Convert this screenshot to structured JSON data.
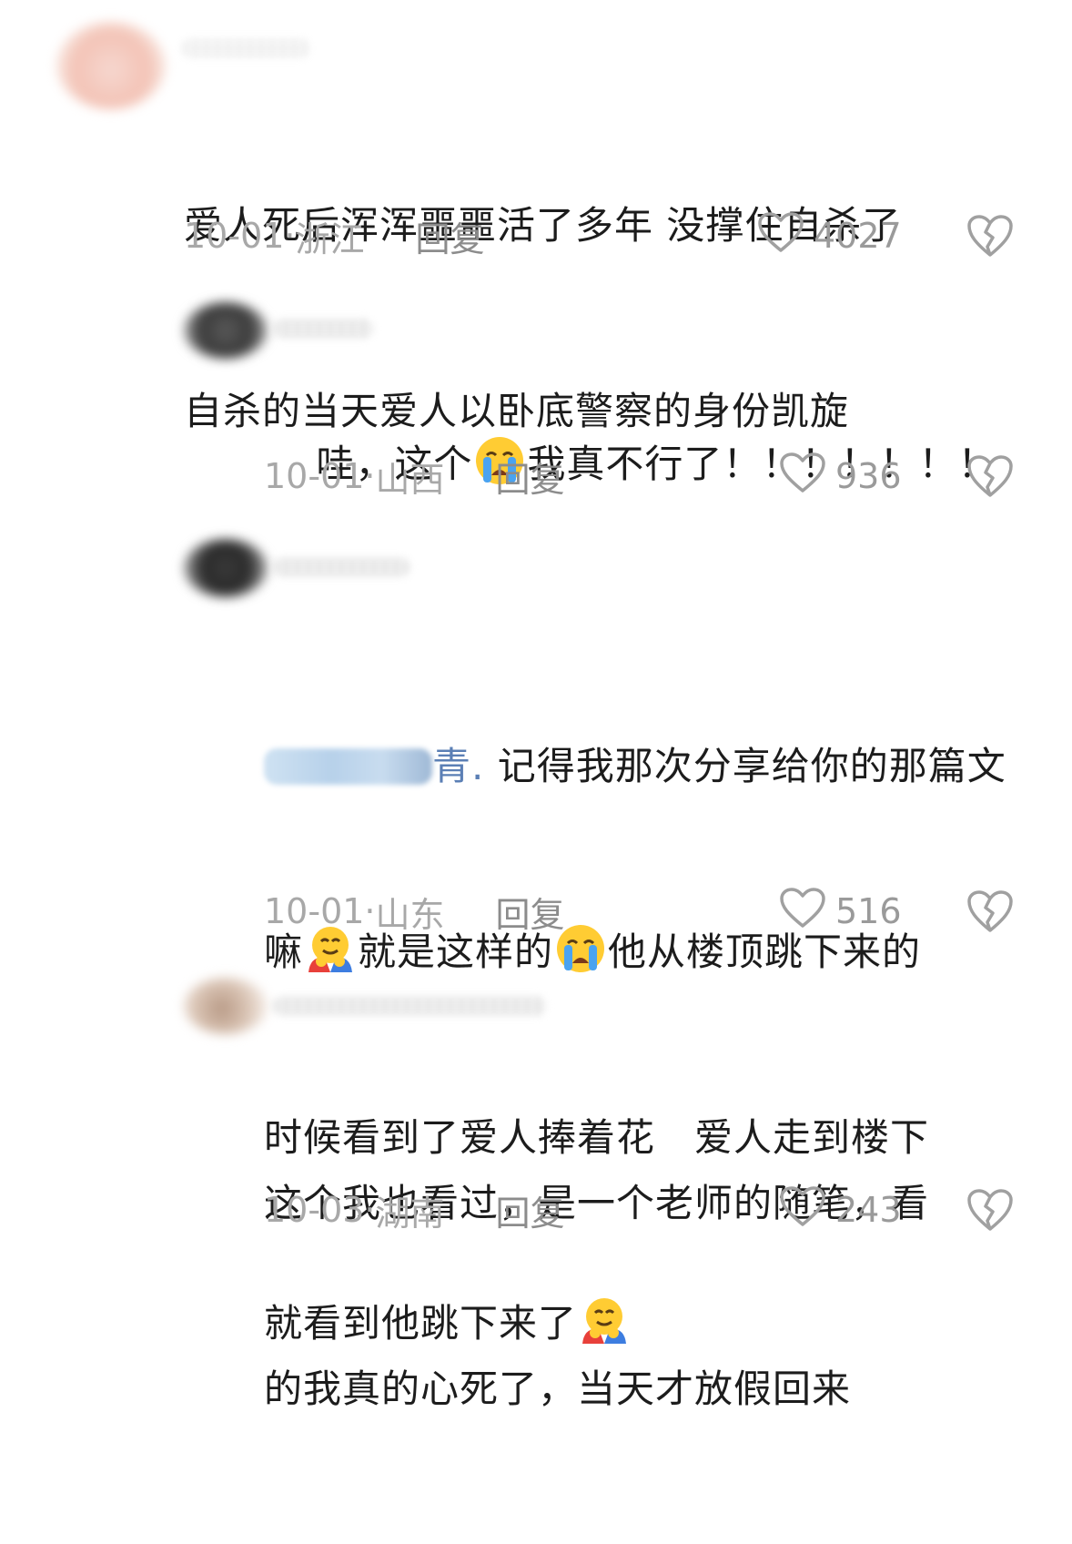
{
  "comments": [
    {
      "lines": [
        "爱人死后浑浑噩噩活了多年 没撑住自杀了",
        "自杀的当天爱人以卧底警察的身份凯旋"
      ],
      "date": "10-01",
      "region": "浙江",
      "reply_label": "回复",
      "likes": "4027"
    },
    {
      "text_a": "哇，这个",
      "text_b": "我真不行了！！！！！！！",
      "emoji": "loudly-crying-face",
      "date": "10-01",
      "region": "山西",
      "reply_label": "回复",
      "likes": "936"
    },
    {
      "mention_suffix": "青.",
      "line1": " 记得我那次分享给你的那篇文",
      "line2a": "嘛",
      "line2b": "就是这样的",
      "line2c": "他从楼顶跳下来的",
      "line3": "时候看到了爱人捧着花　爱人走到楼下",
      "line4": "就看到他跳下来了",
      "emojis": [
        "hugging-face",
        "loudly-crying-face",
        "hugging-face"
      ],
      "date": "10-01",
      "region": "山东",
      "reply_label": "回复",
      "likes": "516"
    },
    {
      "lines": [
        "这个我也看过，是一个老师的随笔，看",
        "的我真的心死了，当天才放假回来"
      ],
      "date": "10-03",
      "region": "湖南",
      "reply_label": "回复",
      "likes": "243"
    }
  ],
  "meta_separator": " · ",
  "icons": {
    "like": "heart-outline-icon",
    "dislike": "broken-heart-icon"
  },
  "colors": {
    "text": "#1c1c1c",
    "meta": "#a8a8a8",
    "icon": "#9a9a9a"
  }
}
